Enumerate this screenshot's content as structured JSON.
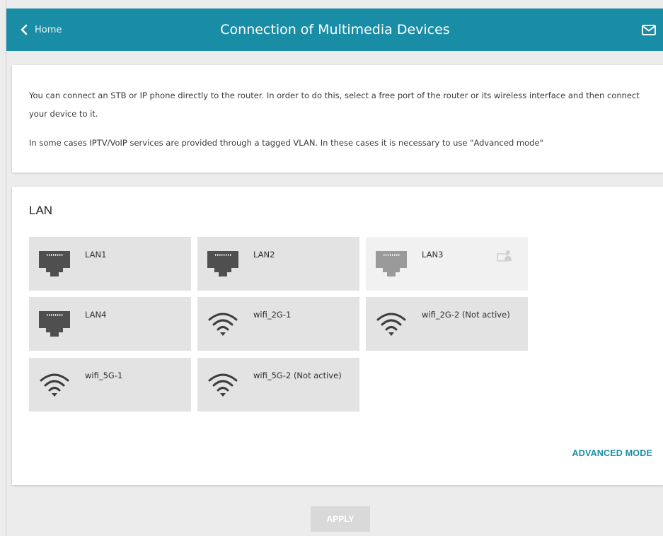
{
  "header": {
    "back_label": "Home",
    "title": "Connection of Multimedia Devices",
    "back_icon": "chevron-left-icon",
    "mail_icon": "envelope-icon"
  },
  "info": {
    "paragraph1": "You can connect an STB or IP phone directly to the router. In order to do this, select a free port of the router or its wireless interface and then connect your device to it.",
    "paragraph2": "In some cases IPTV/VoIP services are provided through a tagged VLAN. In these cases it is necessary to use \"Advanced mode\""
  },
  "lan": {
    "title": "LAN",
    "ports": [
      {
        "label": "LAN1",
        "icon": "ethernet-port-icon",
        "available": true
      },
      {
        "label": "LAN2",
        "icon": "ethernet-port-icon",
        "available": true
      },
      {
        "label": "LAN3",
        "icon": "ethernet-port-icon",
        "available": false,
        "badge_icon": "connected-device-icon"
      },
      {
        "label": "LAN4",
        "icon": "ethernet-port-icon",
        "available": true
      },
      {
        "label": "wifi_2G-1",
        "icon": "wifi-icon",
        "available": true
      },
      {
        "label": "wifi_2G-2 (Not active)",
        "icon": "wifi-icon",
        "available": true
      },
      {
        "label": "wifi_5G-1",
        "icon": "wifi-icon",
        "available": true
      },
      {
        "label": "wifi_5G-2 (Not active)",
        "icon": "wifi-icon",
        "available": true
      }
    ],
    "advanced_mode_label": "ADVANCED MODE"
  },
  "footer": {
    "apply_label": "APPLY"
  },
  "colors": {
    "accent": "#1a8da6",
    "tile_bg": "#e3e3e3",
    "tile_disabled_bg": "#f1f1f1",
    "apply_disabled": "#d9d9d9"
  }
}
